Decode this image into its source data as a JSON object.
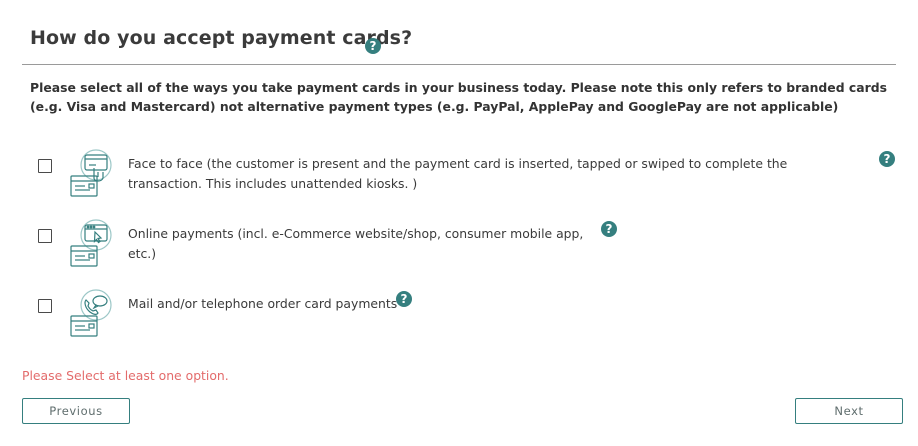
{
  "header": {
    "title": "How do you accept payment cards?",
    "help_glyph": "?"
  },
  "intro": "Please select all of the ways you take payment cards in your business today. Please note this only refers to branded cards (e.g. Visa and Mastercard) not alternative payment types (e.g. PayPal, ApplePay and GooglePay are not applicable)",
  "options": [
    {
      "icon": "card-terminal-icon",
      "checked": false,
      "label": "Face to face (the customer is present and the payment card is inserted, tapped or swiped to complete the transaction. This includes unattended kiosks. )",
      "help_glyph": "?"
    },
    {
      "icon": "online-browser-payment-icon",
      "checked": false,
      "label": "Online payments (incl. e-Commerce website/shop, consumer mobile app, etc.)",
      "help_glyph": "?"
    },
    {
      "icon": "phone-chat-payment-icon",
      "checked": false,
      "label": "Mail and/or telephone order card payments",
      "help_glyph": "?"
    }
  ],
  "error_message": "Please Select at least one option.",
  "buttons": {
    "previous": "Previous",
    "next": "Next"
  },
  "colors": {
    "accent": "#357f7f",
    "error": "#e36b6b",
    "text": "#3a3a3a"
  }
}
